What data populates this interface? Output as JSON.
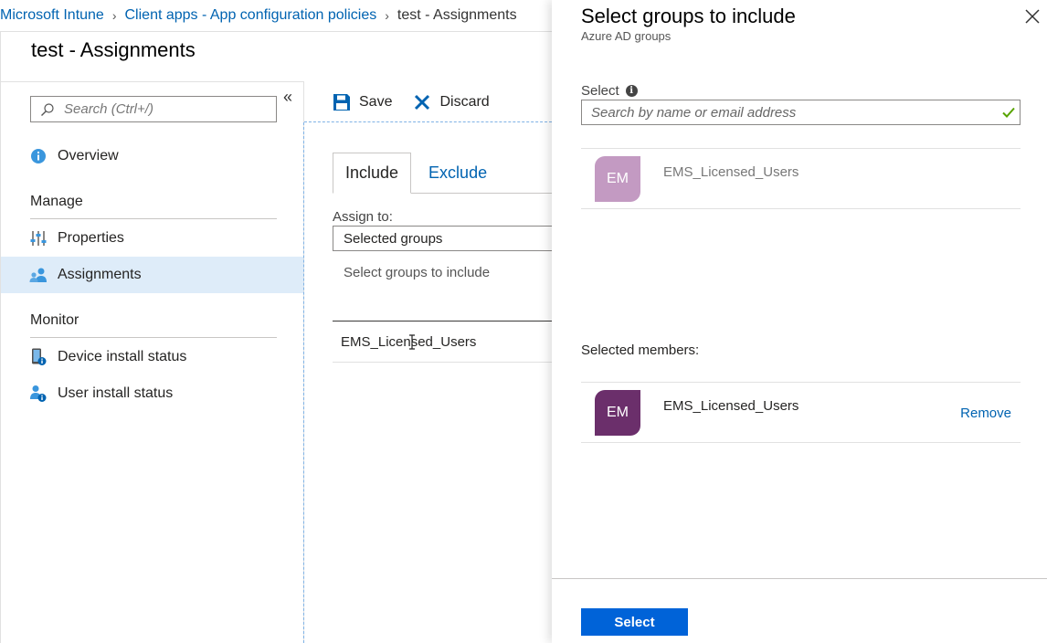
{
  "breadcrumb": {
    "items": [
      "Microsoft Intune",
      "Client apps - App configuration policies"
    ],
    "current": "test - Assignments"
  },
  "blade": {
    "title": "test - Assignments"
  },
  "leftnav": {
    "search_placeholder": "Search (Ctrl+/)",
    "collapse_glyph": "«",
    "overview_label": "Overview",
    "manage_header": "Manage",
    "properties_label": "Properties",
    "assignments_label": "Assignments",
    "monitor_header": "Monitor",
    "device_install_label": "Device install status",
    "user_install_label": "User install status"
  },
  "toolbar": {
    "save_label": "Save",
    "discard_label": "Discard"
  },
  "content": {
    "tabs": [
      "Include",
      "Exclude"
    ],
    "assign_to_label": "Assign to:",
    "assign_to_value": "Selected groups",
    "select_groups_link": "Select groups to include",
    "group_rows": [
      "EMS_Licensed_Users"
    ]
  },
  "panel": {
    "title": "Select groups to include",
    "subtitle": "Azure AD groups",
    "select_label": "Select",
    "info_glyph": "i",
    "search_placeholder": "Search by name or email address",
    "results": [
      {
        "initials": "EM",
        "name": "EMS_Licensed_Users",
        "avatar_color": "#c39ac2"
      }
    ],
    "selected_members_label": "Selected members:",
    "members": [
      {
        "initials": "EM",
        "name": "EMS_Licensed_Users",
        "avatar_color": "#6b2f6b",
        "action": "Remove"
      }
    ],
    "select_button": "Select"
  },
  "colors": {
    "link": "#0063b1",
    "accent": "#0063d8",
    "active_nav_bg": "#deecf9",
    "check_green": "#57a300"
  }
}
